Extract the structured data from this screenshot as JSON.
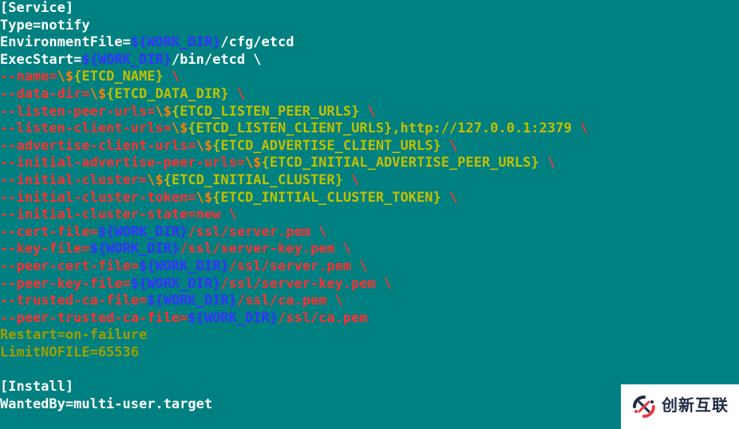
{
  "code": {
    "lines": [
      [
        [
          "c-white",
          "[Service]"
        ]
      ],
      [
        [
          "c-white",
          "Type=notify"
        ]
      ],
      [
        [
          "c-white",
          "EnvironmentFile="
        ],
        [
          "c-blue",
          "${WORK_DIR}"
        ],
        [
          "c-white",
          "/cfg/etcd"
        ]
      ],
      [
        [
          "c-white",
          "ExecStart="
        ],
        [
          "c-blue",
          "${WORK_DIR}"
        ],
        [
          "c-white",
          "/bin/etcd \\"
        ]
      ],
      [
        [
          "c-red",
          "--name="
        ],
        [
          "c-orange",
          "\\$"
        ],
        [
          "c-khaki",
          "{ETCD_NAME}"
        ],
        [
          "c-red",
          " \\"
        ]
      ],
      [
        [
          "c-red",
          "--data-dir="
        ],
        [
          "c-orange",
          "\\$"
        ],
        [
          "c-khaki",
          "{ETCD_DATA_DIR}"
        ],
        [
          "c-red",
          " \\"
        ]
      ],
      [
        [
          "c-red",
          "--listen-peer-urls="
        ],
        [
          "c-orange",
          "\\$"
        ],
        [
          "c-khaki",
          "{ETCD_LISTEN_PEER_URLS}"
        ],
        [
          "c-red",
          " \\"
        ]
      ],
      [
        [
          "c-red",
          "--listen-client-urls="
        ],
        [
          "c-orange",
          "\\$"
        ],
        [
          "c-khaki",
          "{ETCD_LISTEN_CLIENT_URLS},http://127.0.0.1:2379"
        ],
        [
          "c-red",
          " \\"
        ]
      ],
      [
        [
          "c-red",
          "--advertise-client-urls="
        ],
        [
          "c-orange",
          "\\$"
        ],
        [
          "c-khaki",
          "{ETCD_ADVERTISE_CLIENT_URLS}"
        ],
        [
          "c-red",
          " \\"
        ]
      ],
      [
        [
          "c-red",
          "--initial-advertise-peer-urls="
        ],
        [
          "c-orange",
          "\\$"
        ],
        [
          "c-khaki",
          "{ETCD_INITIAL_ADVERTISE_PEER_URLS}"
        ],
        [
          "c-red",
          " \\"
        ]
      ],
      [
        [
          "c-red",
          "--initial-cluster="
        ],
        [
          "c-orange",
          "\\$"
        ],
        [
          "c-khaki",
          "{ETCD_INITIAL_CLUSTER}"
        ],
        [
          "c-red",
          " \\"
        ]
      ],
      [
        [
          "c-red",
          "--initial-cluster-token="
        ],
        [
          "c-orange",
          "\\$"
        ],
        [
          "c-khaki",
          "{ETCD_INITIAL_CLUSTER_TOKEN}"
        ],
        [
          "c-red",
          " \\"
        ]
      ],
      [
        [
          "c-red",
          "--initial-cluster-state=new \\"
        ]
      ],
      [
        [
          "c-red",
          "--cert-file="
        ],
        [
          "c-blue",
          "${WORK_DIR}"
        ],
        [
          "c-red",
          "/ssl/server.pem \\"
        ]
      ],
      [
        [
          "c-red",
          "--key-file="
        ],
        [
          "c-blue",
          "${WORK_DIR}"
        ],
        [
          "c-red",
          "/ssl/server-key.pem \\"
        ]
      ],
      [
        [
          "c-red",
          "--peer-cert-file="
        ],
        [
          "c-blue",
          "${WORK_DIR}"
        ],
        [
          "c-red",
          "/ssl/server.pem \\"
        ]
      ],
      [
        [
          "c-red",
          "--peer-key-file="
        ],
        [
          "c-blue",
          "${WORK_DIR}"
        ],
        [
          "c-red",
          "/ssl/server-key.pem \\"
        ]
      ],
      [
        [
          "c-red",
          "--trusted-ca-file="
        ],
        [
          "c-blue",
          "${WORK_DIR}"
        ],
        [
          "c-red",
          "/ssl/ca.pem \\"
        ]
      ],
      [
        [
          "c-red",
          "--peer-trusted-ca-file="
        ],
        [
          "c-blue",
          "${WORK_DIR}"
        ],
        [
          "c-red",
          "/ssl/ca.pem"
        ]
      ],
      [
        [
          "c-darkkhaki",
          "Restart=on-failure"
        ]
      ],
      [
        [
          "c-darkkhaki",
          "LimitNOFILE=65536"
        ]
      ],
      [
        [
          "c-white",
          ""
        ]
      ],
      [
        [
          "c-white",
          "[Install]"
        ]
      ],
      [
        [
          "c-white",
          "WantedBy=multi-user.target"
        ]
      ]
    ]
  },
  "watermark": {
    "text": "创新互联"
  }
}
